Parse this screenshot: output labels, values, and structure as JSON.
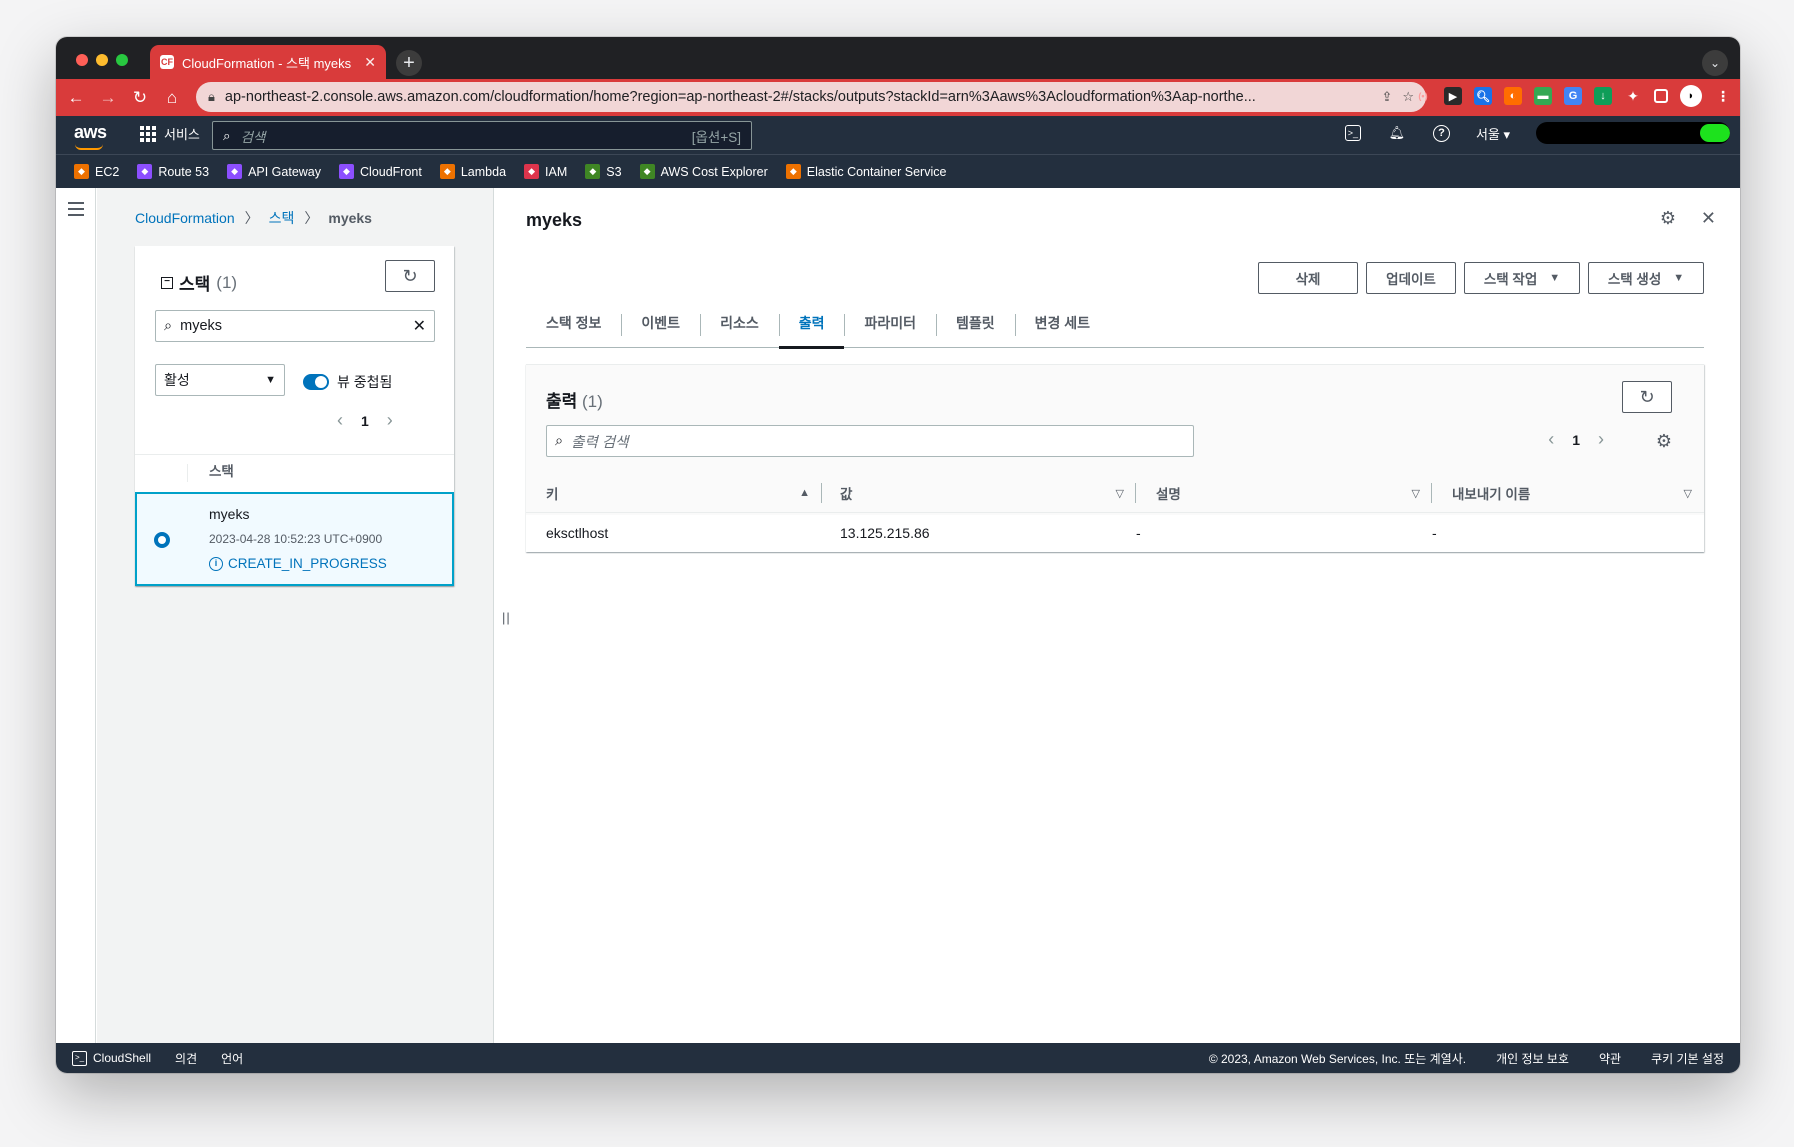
{
  "browser": {
    "tab_title": "CloudFormation - 스택 myeks",
    "url": "ap-northeast-2.console.aws.amazon.com/cloudformation/home?region=ap-northeast-2#/stacks/outputs?stackId=arn%3Aaws%3Acloudformation%3Aap-northe...",
    "tab_color": "#d93b3b"
  },
  "awsnav": {
    "logo": "aws",
    "services_label": "서비스",
    "search_placeholder": "검색",
    "search_shortcut": "[옵션+S]",
    "region": "서울"
  },
  "favorites": [
    {
      "label": "EC2",
      "color": "#ed7100"
    },
    {
      "label": "Route 53",
      "color": "#8c4fff"
    },
    {
      "label": "API Gateway",
      "color": "#8c4fff"
    },
    {
      "label": "CloudFront",
      "color": "#8c4fff"
    },
    {
      "label": "Lambda",
      "color": "#ed7100"
    },
    {
      "label": "IAM",
      "color": "#dd344c"
    },
    {
      "label": "S3",
      "color": "#3f8624"
    },
    {
      "label": "AWS Cost Explorer",
      "color": "#3f8624"
    },
    {
      "label": "Elastic Container Service",
      "color": "#ed7100"
    }
  ],
  "breadcrumb": {
    "root": "CloudFormation",
    "level2": "스택",
    "current": "myeks"
  },
  "stack_panel": {
    "title": "스택",
    "count": "(1)",
    "search_value": "myeks",
    "filter_value": "활성",
    "toggle_label": "뷰 중첩됨",
    "page": "1",
    "column_header": "스택",
    "stack": {
      "name": "myeks",
      "created": "2023-04-28 10:52:23 UTC+0900",
      "status": "CREATE_IN_PROGRESS"
    }
  },
  "detail": {
    "title": "myeks",
    "actions": {
      "delete": "삭제",
      "update": "업데이트",
      "stack_actions": "스택 작업",
      "create_stack": "스택 생성"
    },
    "tabs": [
      "스택 정보",
      "이벤트",
      "리소스",
      "출력",
      "파라미터",
      "템플릿",
      "변경 세트"
    ],
    "active_tab": "출력",
    "outputs": {
      "title": "출력",
      "count": "(1)",
      "search_placeholder": "출력 검색",
      "page": "1",
      "columns": [
        "키",
        "값",
        "설명",
        "내보내기 이름"
      ],
      "rows": [
        {
          "key": "eksctlhost",
          "value": "13.125.215.86",
          "description": "-",
          "export_name": "-"
        }
      ]
    }
  },
  "footer": {
    "cloudshell": "CloudShell",
    "feedback": "의견",
    "language": "언어",
    "copyright": "© 2023, Amazon Web Services, Inc. 또는 계열사.",
    "privacy": "개인 정보 보호",
    "terms": "약관",
    "cookie": "쿠키 기본 설정"
  }
}
